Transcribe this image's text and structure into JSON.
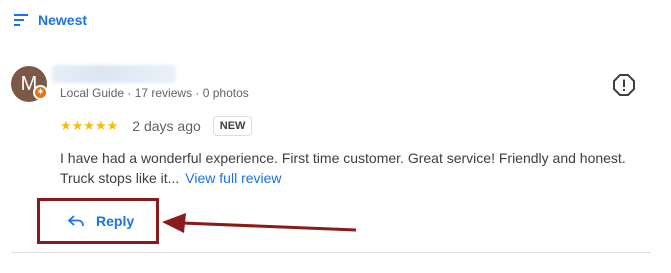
{
  "sort": {
    "label": "Newest",
    "icon": "sort-icon"
  },
  "review": {
    "avatar_letter": "M",
    "badge_icon": "local-guide-badge-icon",
    "meta": "Local Guide · 17 reviews · 0 photos",
    "stars": "★★★★★",
    "rating": 5,
    "time": "2 days ago",
    "new_badge": "NEW",
    "text": "I have had a wonderful experience. First time customer. Great service! Friendly and honest. Truck stops like it...",
    "view_full": "View full review",
    "reply_label": "Reply",
    "reply_icon": "reply-icon",
    "more_icon": "report-icon"
  },
  "colors": {
    "accent": "#1a73e8",
    "star": "#fbbc04",
    "avatar": "#7b5848",
    "badge": "#e8710a",
    "highlight": "#8b1a1a"
  }
}
